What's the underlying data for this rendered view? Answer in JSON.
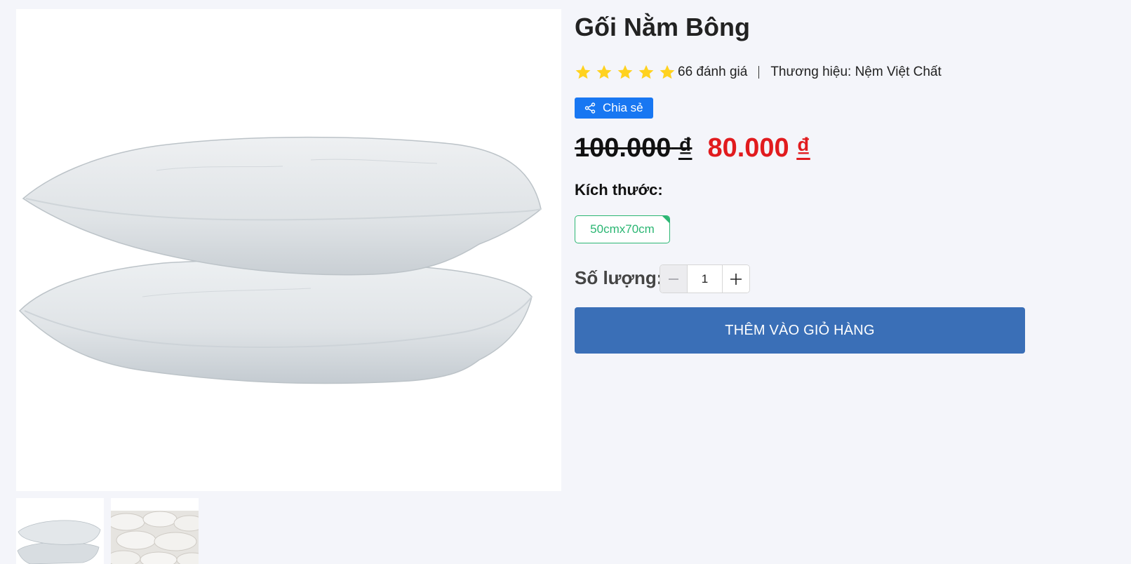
{
  "product": {
    "title": "Gối Nằm Bông",
    "rating": 5,
    "review_count_text": "66 đánh giá",
    "brand_text": "Thương hiệu: Nệm Việt Chất",
    "share_label": "Chia sẻ",
    "old_price": "100.000",
    "new_price": "80.000",
    "currency": "₫",
    "size_label": "Kích thước:",
    "size_options": [
      "50cmx70cm"
    ],
    "quantity_label": "Số lượng:",
    "quantity_value": "1",
    "add_to_cart_label": "THÊM VÀO GIỎ HÀNG"
  },
  "colors": {
    "accent_blue": "#3a6fb7",
    "share_blue": "#1877f2",
    "price_red": "#e11b1e",
    "size_green": "#2bb673",
    "star_yellow": "#ffd21f"
  },
  "icons": {
    "share": "share-icon",
    "star": "star-icon",
    "minus": "minus-icon",
    "plus": "plus-icon"
  },
  "gallery": {
    "thumbnail_count": 2,
    "selected_index": 0
  }
}
